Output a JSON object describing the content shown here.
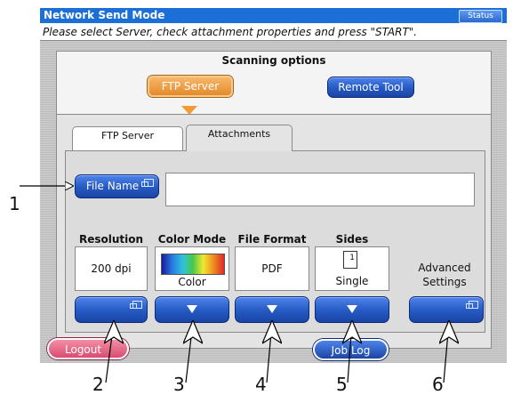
{
  "window": {
    "title": "Network Send Mode",
    "status_label": "Status"
  },
  "instruction": "Please select Server, check attachment properties and press \"START\".",
  "scanning_options": {
    "title": "Scanning options",
    "ftp_server_label": "FTP Server",
    "remote_tool_label": "Remote Tool"
  },
  "tabs": [
    {
      "label": "FTP Server",
      "active": false
    },
    {
      "label": "Attachments",
      "active": true
    }
  ],
  "file_name": {
    "label": "File Name",
    "value": ""
  },
  "settings": {
    "resolution": {
      "label": "Resolution",
      "value": "200 dpi"
    },
    "color_mode": {
      "label": "Color Mode",
      "value": "Color"
    },
    "file_format": {
      "label": "File Format",
      "value": "PDF"
    },
    "sides": {
      "label": "Sides",
      "value": "Single",
      "icon_number": "1"
    },
    "advanced": {
      "label_line1": "Advanced",
      "label_line2": "Settings"
    }
  },
  "footer": {
    "logout_label": "Logout",
    "joblog_label": "Job Log"
  },
  "callouts": [
    "1",
    "2",
    "3",
    "4",
    "5",
    "6"
  ],
  "colors": {
    "title_bar": "#1c6fd6",
    "selected_button": "#e48a2a",
    "button_blue": "#2559c3",
    "logout": "#d94c72",
    "arrow_indicator": "#f29a33"
  }
}
